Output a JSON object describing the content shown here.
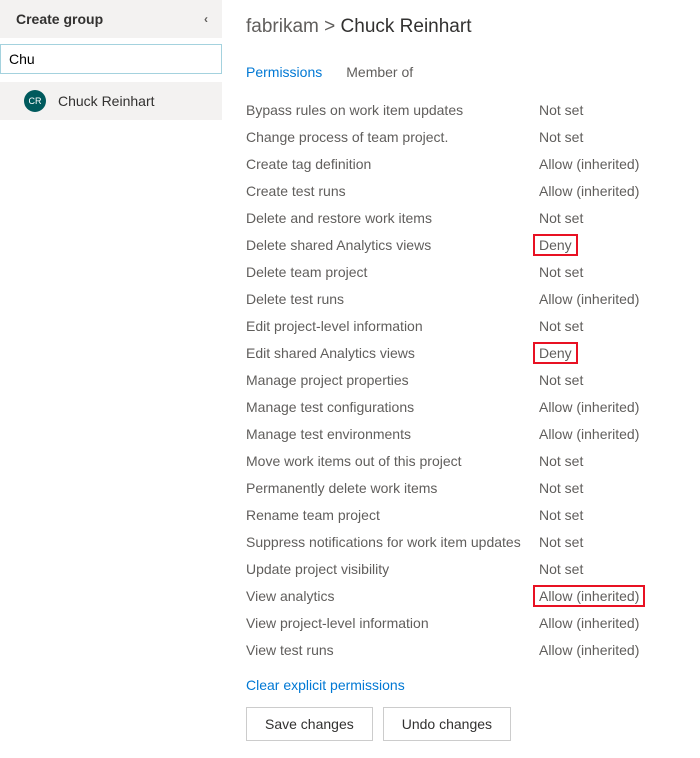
{
  "left": {
    "create_group": "Create group",
    "search_value": "Chu",
    "avatar_initials": "CR",
    "selected_user": "Chuck Reinhart"
  },
  "breadcrumb": {
    "parent": "fabrikam",
    "separator": ">",
    "current": "Chuck Reinhart"
  },
  "tabs": {
    "permissions": "Permissions",
    "member_of": "Member of"
  },
  "permissions": [
    {
      "label": "Bypass rules on work item updates",
      "value": "Not set",
      "hl": false
    },
    {
      "label": "Change process of team project.",
      "value": "Not set",
      "hl": false
    },
    {
      "label": "Create tag definition",
      "value": "Allow (inherited)",
      "hl": false
    },
    {
      "label": "Create test runs",
      "value": "Allow (inherited)",
      "hl": false
    },
    {
      "label": "Delete and restore work items",
      "value": "Not set",
      "hl": false
    },
    {
      "label": "Delete shared Analytics views",
      "value": "Deny",
      "hl": true
    },
    {
      "label": "Delete team project",
      "value": "Not set",
      "hl": false
    },
    {
      "label": "Delete test runs",
      "value": "Allow (inherited)",
      "hl": false
    },
    {
      "label": "Edit project-level information",
      "value": "Not set",
      "hl": false
    },
    {
      "label": "Edit shared Analytics views",
      "value": "Deny",
      "hl": true
    },
    {
      "label": "Manage project properties",
      "value": "Not set",
      "hl": false
    },
    {
      "label": "Manage test configurations",
      "value": "Allow (inherited)",
      "hl": false
    },
    {
      "label": "Manage test environments",
      "value": "Allow (inherited)",
      "hl": false
    },
    {
      "label": "Move work items out of this project",
      "value": "Not set",
      "hl": false
    },
    {
      "label": "Permanently delete work items",
      "value": "Not set",
      "hl": false
    },
    {
      "label": "Rename team project",
      "value": "Not set",
      "hl": false
    },
    {
      "label": "Suppress notifications for work item updates",
      "value": "Not set",
      "hl": false
    },
    {
      "label": "Update project visibility",
      "value": "Not set",
      "hl": false
    },
    {
      "label": "View analytics",
      "value": "Allow (inherited)",
      "hl": true
    },
    {
      "label": "View project-level information",
      "value": "Allow (inherited)",
      "hl": false
    },
    {
      "label": "View test runs",
      "value": "Allow (inherited)",
      "hl": false
    }
  ],
  "actions": {
    "clear": "Clear explicit permissions",
    "save": "Save changes",
    "undo": "Undo changes"
  }
}
